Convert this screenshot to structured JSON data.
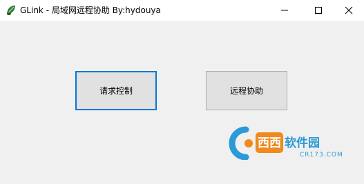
{
  "window": {
    "title": "GLink - 局域网远程协助 By:hydouya",
    "app_icon": "leaf-icon",
    "controls": {
      "minimize_icon": "minimize-icon",
      "maximize_icon": "maximize-icon",
      "close_icon": "close-icon"
    }
  },
  "main": {
    "request_control_label": "请求控制",
    "remote_assist_label": "远程协助"
  },
  "watermark": {
    "brand": "西西软件园",
    "domain": "CR173.COM"
  },
  "colors": {
    "title_bg": "#ffffff",
    "client_bg": "#f0f0f0",
    "button_bg": "#e1e1e1",
    "focus_border": "#0078d7",
    "watermark_blue": "#2b9ad6",
    "watermark_orange": "#f08a1c"
  }
}
